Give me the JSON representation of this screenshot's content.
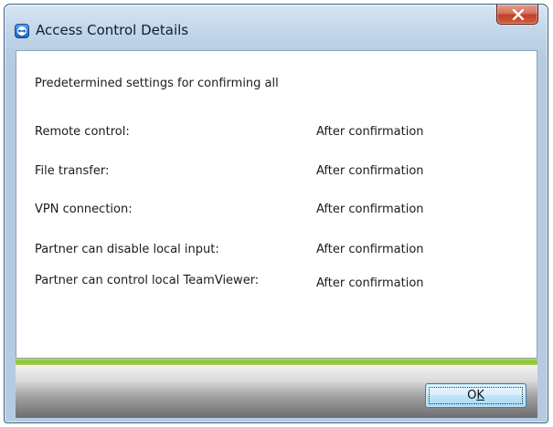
{
  "window": {
    "title": "Access Control Details",
    "app_icon": "teamviewer-icon",
    "close_icon": "close-icon"
  },
  "content": {
    "heading": "Predetermined settings for confirming all",
    "rows": [
      {
        "label": "Remote control:",
        "value": "After confirmation"
      },
      {
        "label": "File transfer:",
        "value": "After confirmation"
      },
      {
        "label": "VPN connection:",
        "value": "After confirmation"
      },
      {
        "label": "Partner can disable local input:",
        "value": "After confirmation"
      },
      {
        "label": "Partner can control local TeamViewer:",
        "value": "After confirmation"
      }
    ]
  },
  "footer": {
    "ok_label_prefix": "O",
    "ok_label_accel": "K"
  },
  "colors": {
    "accent_green": "#8bc23a",
    "close_red": "#c0412a",
    "button_blue": "#bee6fd"
  }
}
